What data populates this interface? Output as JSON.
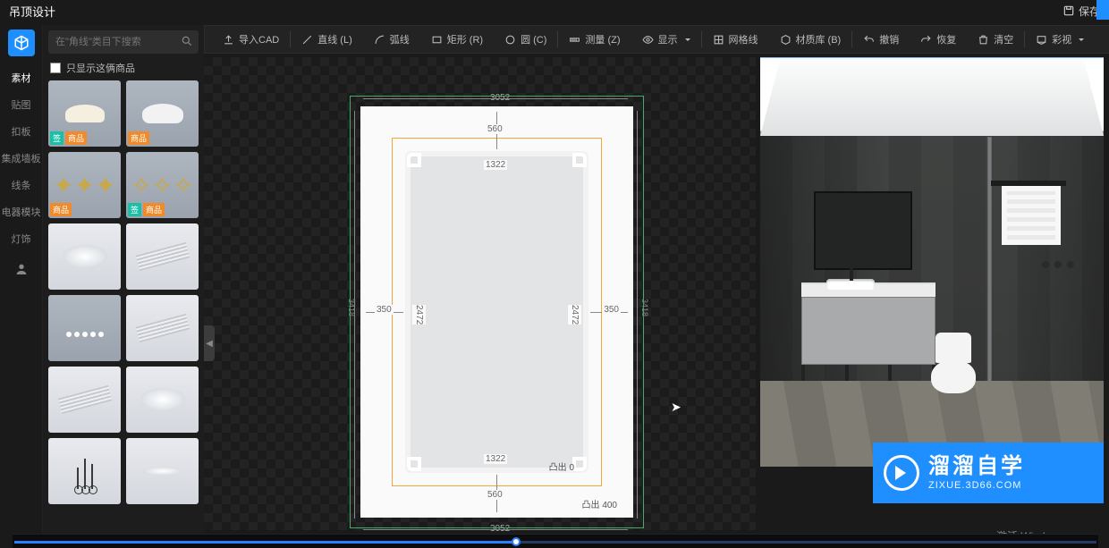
{
  "header": {
    "title": "吊顶设计",
    "save": "保存"
  },
  "search": {
    "placeholder": "在\"角线\"类目下搜索"
  },
  "filter": {
    "label": "只显示这俩商品"
  },
  "categories": [
    "素材",
    "贴图",
    "扣板",
    "集成墙板",
    "线条",
    "电器模块",
    "灯饰"
  ],
  "toolbar": {
    "importcad": "导入CAD",
    "line": "直线 (L)",
    "arc": "弧线",
    "rect": "矩形 (R)",
    "circle": "圆 (C)",
    "measure": "测量 (Z)",
    "display": "显示",
    "grid": "网格线",
    "material": "材质库 (B)",
    "undo": "撤销",
    "redo": "恢复",
    "clear": "清空",
    "view": "彩视"
  },
  "dims": {
    "outer_w": "3052",
    "outer_h": "3418",
    "top_gap": "560",
    "bottom_gap": "560",
    "inner_w": "1322",
    "inner_h": "2472",
    "side_gap": "350",
    "protrude_label": "凸出",
    "protrude_inner": "0",
    "protrude_outer": "400"
  },
  "badges": {
    "teal": "签",
    "orange": "商品"
  },
  "watermark": {
    "main": "溜溜自学",
    "sub": "ZIXUE.3D66.COM"
  },
  "windows": {
    "line1": "激活 Windows"
  }
}
